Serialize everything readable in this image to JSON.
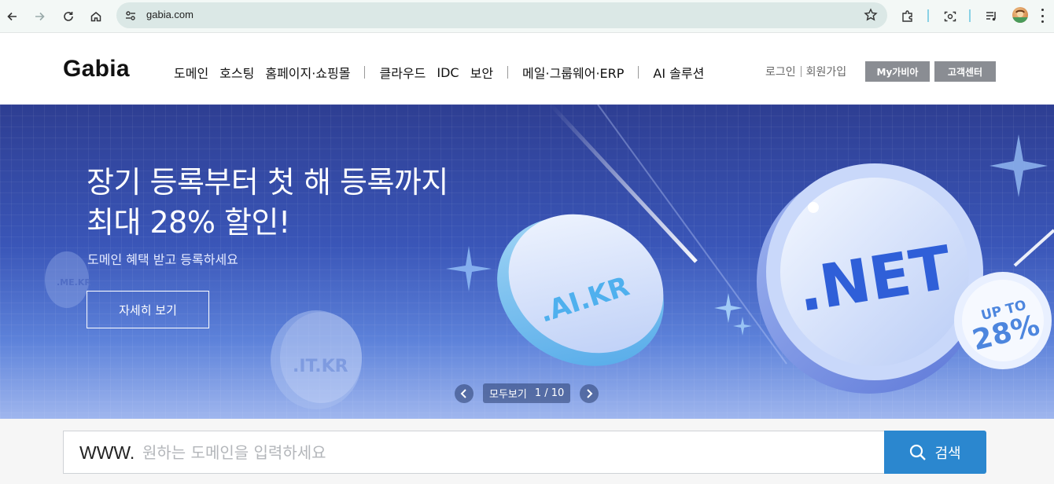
{
  "browser": {
    "url": "gabia.com"
  },
  "header": {
    "logo": "Gabia",
    "nav_groups": [
      [
        "도메인",
        "호스팅",
        "홈페이지·쇼핑몰"
      ],
      [
        "클라우드",
        "IDC",
        "보안"
      ],
      [
        "메일·그룹웨어·ERP"
      ],
      [
        "AI 솔루션"
      ]
    ],
    "login": "로그인",
    "signup": "회원가입",
    "my_gabia": "My가비아",
    "customer_center": "고객센터"
  },
  "hero": {
    "title_line1": "장기 등록부터 첫 해 등록까지",
    "title_line2": "최대 28% 할인!",
    "subtitle": "도메인 혜택 받고 등록하세요",
    "cta": "자세히 보기",
    "coin_main": ".NET",
    "coin_mid": ".AI.KR",
    "coin_small": ".IT.KR",
    "coin_tiny": ".ME.KR",
    "badge_line1": "UP TO",
    "badge_line2": "28%",
    "pager_all": "모두보기",
    "pager_count": "1 / 10"
  },
  "search": {
    "prefix": "WWW.",
    "placeholder": "원하는 도메인을 입력하세요",
    "button": "검색"
  },
  "colors": {
    "brand_button": "#2b87cf",
    "header_button": "#8a8d93"
  }
}
